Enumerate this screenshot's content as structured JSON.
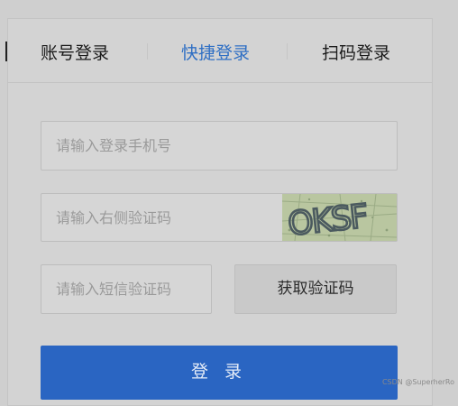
{
  "tabs": [
    {
      "label": "账号登录"
    },
    {
      "label": "快捷登录"
    },
    {
      "label": "扫码登录"
    }
  ],
  "form": {
    "phone_placeholder": "请输入登录手机号",
    "captcha_placeholder": "请输入右侧验证码",
    "captcha_text": "OKSF",
    "sms_placeholder": "请输入短信验证码",
    "sms_button_label": "获取验证码",
    "login_button_label": "登 录"
  },
  "watermark": "CSDN @SuperherRo",
  "colors": {
    "accent": "#2a65c2",
    "active_tab": "#2f6fc4",
    "captcha_bg": "#b7c49e"
  }
}
